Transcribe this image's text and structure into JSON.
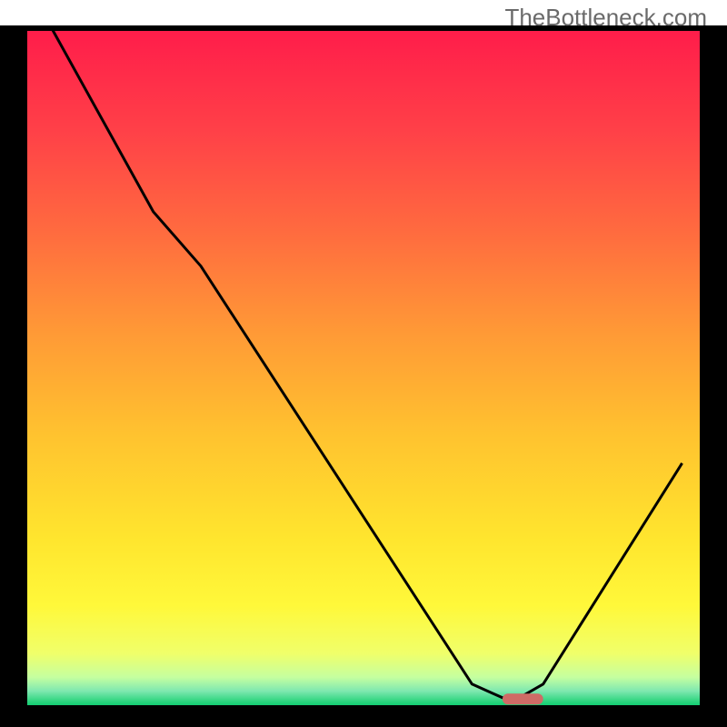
{
  "watermark": "TheBottleneck.com",
  "chart_data": {
    "type": "line",
    "title": "",
    "xlabel": "",
    "ylabel": "",
    "xlim": [
      0,
      100
    ],
    "ylim": [
      0,
      100
    ],
    "x": [
      4,
      19,
      26,
      66,
      70.5,
      73,
      76.5,
      97
    ],
    "values": [
      100,
      73,
      65,
      3.5,
      1.5,
      1.5,
      3.5,
      36
    ],
    "optimal_marker": {
      "x_start": 70.5,
      "x_end": 76.5,
      "y": 1.3,
      "color": "#cf6b66"
    },
    "grid": false,
    "background_gradient": {
      "stops": [
        {
          "offset": 0.0,
          "color": "#ff1c4a"
        },
        {
          "offset": 0.15,
          "color": "#ff4048"
        },
        {
          "offset": 0.3,
          "color": "#ff6b3f"
        },
        {
          "offset": 0.45,
          "color": "#ff9a36"
        },
        {
          "offset": 0.6,
          "color": "#ffc32f"
        },
        {
          "offset": 0.75,
          "color": "#ffe52e"
        },
        {
          "offset": 0.85,
          "color": "#fff83a"
        },
        {
          "offset": 0.92,
          "color": "#f0ff6a"
        },
        {
          "offset": 0.955,
          "color": "#c5ffa0"
        },
        {
          "offset": 0.975,
          "color": "#7fe8b0"
        },
        {
          "offset": 0.99,
          "color": "#2fd580"
        },
        {
          "offset": 1.0,
          "color": "#00c86a"
        }
      ]
    },
    "frame_color": "#000000",
    "line_color": "#000000",
    "line_width": 3
  }
}
